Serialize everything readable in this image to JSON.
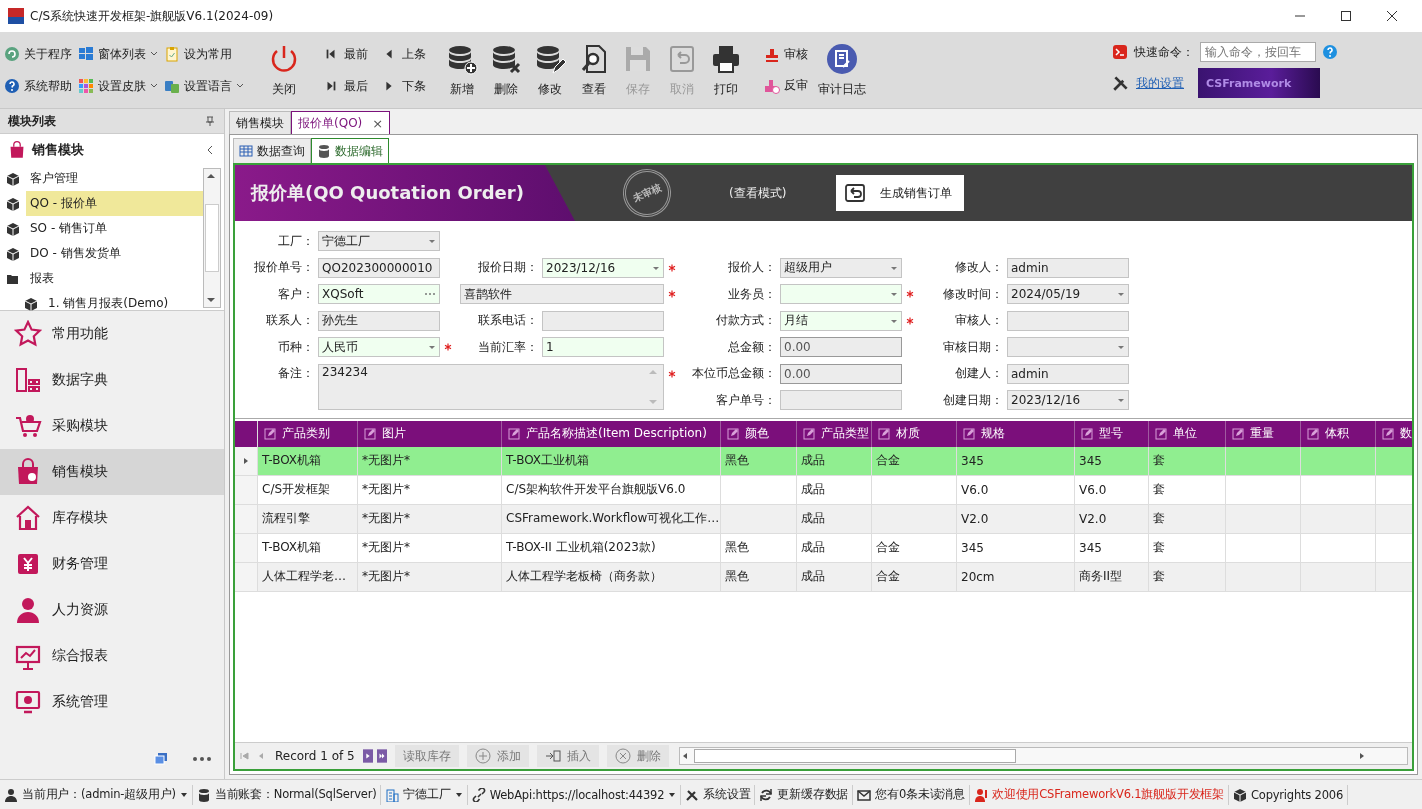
{
  "window": {
    "title": "C/S系统快速开发框架-旗舰版V6.1(2024-09)"
  },
  "toolbar": {
    "quick_links": [
      {
        "label": "关于程序",
        "dropdown": false
      },
      {
        "label": "系统帮助",
        "dropdown": false
      },
      {
        "label": "窗体列表",
        "dropdown": true
      },
      {
        "label": "设置皮肤",
        "dropdown": true
      },
      {
        "label": "设为常用",
        "dropdown": false
      },
      {
        "label": "设置语言",
        "dropdown": true
      }
    ],
    "close": "关闭",
    "navigation": [
      "最前",
      "最后",
      "上条",
      "下条"
    ],
    "actions": [
      {
        "label": "新增",
        "disabled": false
      },
      {
        "label": "删除",
        "disabled": false
      },
      {
        "label": "修改",
        "disabled": false
      },
      {
        "label": "查看",
        "disabled": false
      },
      {
        "label": "保存",
        "disabled": true
      },
      {
        "label": "取消",
        "disabled": true
      },
      {
        "label": "打印",
        "disabled": false
      }
    ],
    "audit": [
      "审核",
      "反审"
    ],
    "audit_log": "审计日志",
    "quick_command": {
      "label": "快速命令：",
      "placeholder": "输入命令，按回车"
    },
    "settings_link": "我的设置",
    "banner": "CSFramework"
  },
  "sidebar": {
    "title": "模块列表",
    "module": "销售模块",
    "tree": [
      {
        "kind": "item",
        "label": "客户管理",
        "selected": false
      },
      {
        "kind": "item",
        "label": "QO - 报价单",
        "selected": true
      },
      {
        "kind": "item",
        "label": "SO - 销售订单",
        "selected": false
      },
      {
        "kind": "item",
        "label": "DO - 销售发货单",
        "selected": false
      },
      {
        "kind": "folder",
        "label": "报表",
        "selected": false,
        "children": [
          {
            "kind": "item",
            "label": "1. 销售月报表(Demo)",
            "selected": false
          }
        ]
      }
    ],
    "modules": [
      {
        "label": "常用功能",
        "selected": false
      },
      {
        "label": "数据字典",
        "selected": false
      },
      {
        "label": "采购模块",
        "selected": false
      },
      {
        "label": "销售模块",
        "selected": true
      },
      {
        "label": "库存模块",
        "selected": false
      },
      {
        "label": "财务管理",
        "selected": false
      },
      {
        "label": "人力资源",
        "selected": false
      },
      {
        "label": "综合报表",
        "selected": false
      },
      {
        "label": "系统管理",
        "selected": false
      }
    ]
  },
  "tabs": [
    {
      "label": "销售模块",
      "selected": false
    },
    {
      "label": "报价单(QO)",
      "selected": true,
      "closable": true
    }
  ],
  "close_tab": "×",
  "inner_tabs": [
    {
      "label": "数据查询",
      "selected": false
    },
    {
      "label": "数据编辑",
      "selected": true
    }
  ],
  "header": {
    "title": "报价单(QO Quotation Order)",
    "stamp": "未审核",
    "mode": "(查看模式)",
    "action": "生成销售订单"
  },
  "form": {
    "columns": [
      [
        {
          "label": "工厂：",
          "value": "宁德工厂",
          "kind": "combo",
          "editable": false
        },
        {
          "label": "报价单号：",
          "value": "QO202300000010",
          "kind": "text",
          "editable": false
        },
        {
          "label": "客户：",
          "value": "XQSoft",
          "kind": "lookup",
          "editable": true
        },
        {
          "label": "联系人：",
          "value": "孙先生",
          "kind": "text",
          "editable": false
        },
        {
          "label": "币种：",
          "value": "人民币",
          "kind": "combo",
          "editable": true,
          "required": true
        },
        {
          "label": "备注：",
          "value": "234234",
          "kind": "memo",
          "editable": false,
          "required": true
        }
      ],
      [
        {
          "label": "报价日期：",
          "value": "2023/12/16",
          "kind": "combo",
          "editable": true,
          "required": true
        },
        {
          "value": "喜鹊软件",
          "kind": "name",
          "editable": false,
          "required": true
        },
        {
          "label": "联系电话：",
          "kind": "text",
          "editable": false
        },
        {
          "label": "当前汇率：",
          "value": "1",
          "kind": "text",
          "editable": true
        }
      ],
      [
        {
          "label": "报价人：",
          "value": "超级用户",
          "kind": "combo",
          "editable": false
        },
        {
          "label": "业务员：",
          "kind": "combo",
          "editable": true,
          "required": true
        },
        {
          "label": "付款方式：",
          "value": "月结",
          "kind": "combo",
          "editable": true,
          "required": true
        },
        {
          "label": "总金额：",
          "value": "0.00",
          "kind": "amount",
          "editable": false
        },
        {
          "label": "本位币总金额：",
          "value": "0.00",
          "kind": "amount",
          "editable": false
        },
        {
          "label": "客户单号：",
          "kind": "text",
          "editable": false
        }
      ],
      [
        {
          "label": "修改人：",
          "value": "admin",
          "kind": "text",
          "editable": false
        },
        {
          "label": "修改时间：",
          "value": "2024/05/19",
          "kind": "combo",
          "editable": false
        },
        {
          "label": "审核人：",
          "kind": "text",
          "editable": false
        },
        {
          "label": "审核日期：",
          "kind": "combo",
          "editable": false
        },
        {
          "label": "创建人：",
          "value": "admin",
          "kind": "text",
          "editable": false
        },
        {
          "label": "创建日期：",
          "value": "2023/12/16",
          "kind": "combo",
          "editable": false
        }
      ]
    ]
  },
  "table": {
    "columns": [
      "产品类别",
      "图片",
      "产品名称描述(Item Description)",
      "颜色",
      "产品类型",
      "材质",
      "规格",
      "型号",
      "单位",
      "重量",
      "体积",
      "数"
    ],
    "rows": [
      {
        "selected": true,
        "cells": [
          "T-BOX机箱",
          "*无图片*",
          "T-BOX工业机箱",
          "黑色",
          "成品",
          "合金",
          "345",
          "345",
          "套",
          "",
          "",
          ""
        ]
      },
      {
        "selected": false,
        "cells": [
          "C/S开发框架",
          "*无图片*",
          "C/S架构软件开发平台旗舰版V6.0",
          "",
          "成品",
          "",
          "V6.0",
          "V6.0",
          "套",
          "",
          "",
          ""
        ]
      },
      {
        "selected": false,
        "cells": [
          "流程引擎",
          "*无图片*",
          "CSFramework.Workflow可视化工作…",
          "",
          "成品",
          "",
          "V2.0",
          "V2.0",
          "套",
          "",
          "",
          ""
        ]
      },
      {
        "selected": false,
        "cells": [
          "T-BOX机箱",
          "*无图片*",
          "T-BOX-II 工业机箱(2023款)",
          "黑色",
          "成品",
          "合金",
          "345",
          "345",
          "套",
          "",
          "",
          ""
        ]
      },
      {
        "selected": false,
        "cells": [
          "人体工程学老…",
          "*无图片*",
          "人体工程学老板椅（商务款）",
          "黑色",
          "成品",
          "合金",
          "20cm",
          "商务II型",
          "套",
          "",
          "",
          ""
        ]
      }
    ]
  },
  "navigator": {
    "record": "Record 1 of 5",
    "buttons": [
      "读取库存",
      "添加",
      "插入",
      "删除"
    ]
  },
  "status_bar": [
    {
      "label": "当前用户：(admin-超级用户)",
      "dropdown": true,
      "alert": false
    },
    {
      "label": "当前账套：Normal(SqlServer)",
      "dropdown": false,
      "alert": false
    },
    {
      "label": "宁德工厂",
      "dropdown": true,
      "alert": false
    },
    {
      "label": "WebApi:https://localhost:44392",
      "dropdown": true,
      "alert": false
    },
    {
      "label": "系统设置",
      "dropdown": false,
      "alert": false
    },
    {
      "label": "更新缓存数据",
      "dropdown": false,
      "alert": false
    },
    {
      "label": "您有0条未读消息",
      "dropdown": false,
      "alert": false
    },
    {
      "label": "欢迎使用CSFrameworkV6.1旗舰版开发框架",
      "dropdown": false,
      "alert": true
    },
    {
      "label": "Copyrights 2006",
      "dropdown": false,
      "alert": false
    }
  ]
}
